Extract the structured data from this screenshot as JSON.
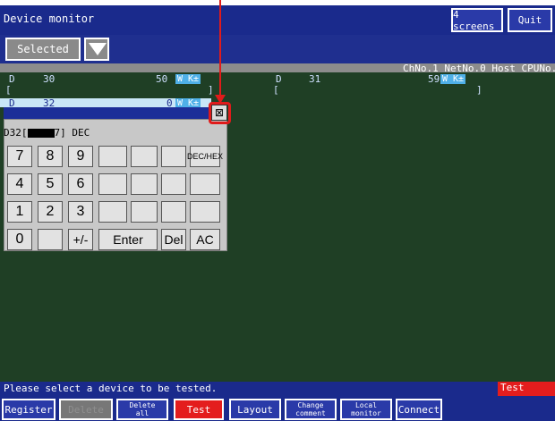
{
  "title": "Device monitor",
  "header_buttons": {
    "screens": "4 screens",
    "quit": "Quit"
  },
  "select": {
    "value": "Selected"
  },
  "info": "ChNo.1 NetNo.0 Host CPUNo.0",
  "rows": [
    {
      "dev": "D",
      "addr": "30",
      "value": "50",
      "fmt": "W K±",
      "open": "[",
      "close": "]"
    },
    {
      "dev": "D",
      "addr": "31",
      "value": "59",
      "fmt": "W K±",
      "open": "[",
      "close": "]"
    },
    {
      "dev": "D",
      "addr": "32",
      "value": "0",
      "fmt": "W K±"
    }
  ],
  "keypad": {
    "display_prefix": "D32[",
    "display_suffix": "7] DEC",
    "close": "⊠",
    "keys": [
      "7",
      "8",
      "9",
      "",
      "",
      "",
      "DEC/HEX",
      "4",
      "5",
      "6",
      "",
      "",
      "",
      "",
      "1",
      "2",
      "3",
      "",
      "",
      "",
      "",
      "0",
      "",
      "+/-",
      "Enter",
      "Del",
      "AC"
    ]
  },
  "status": {
    "message": "Please select a device to be tested.",
    "mode": "Test"
  },
  "bottom": {
    "register": "Register",
    "delete": "Delete",
    "delete_all": [
      "Delete",
      "all"
    ],
    "test": "Test",
    "layout": "Layout",
    "change_comment": [
      "Change",
      "comment"
    ],
    "local_monitor": [
      "Local",
      "monitor"
    ],
    "connect": "Connect"
  },
  "colors": {
    "header": "#1a2a8c",
    "monitor_bg": "#1f3f25",
    "accent_red": "#e41d1d",
    "tag_blue": "#4fb0e8"
  }
}
